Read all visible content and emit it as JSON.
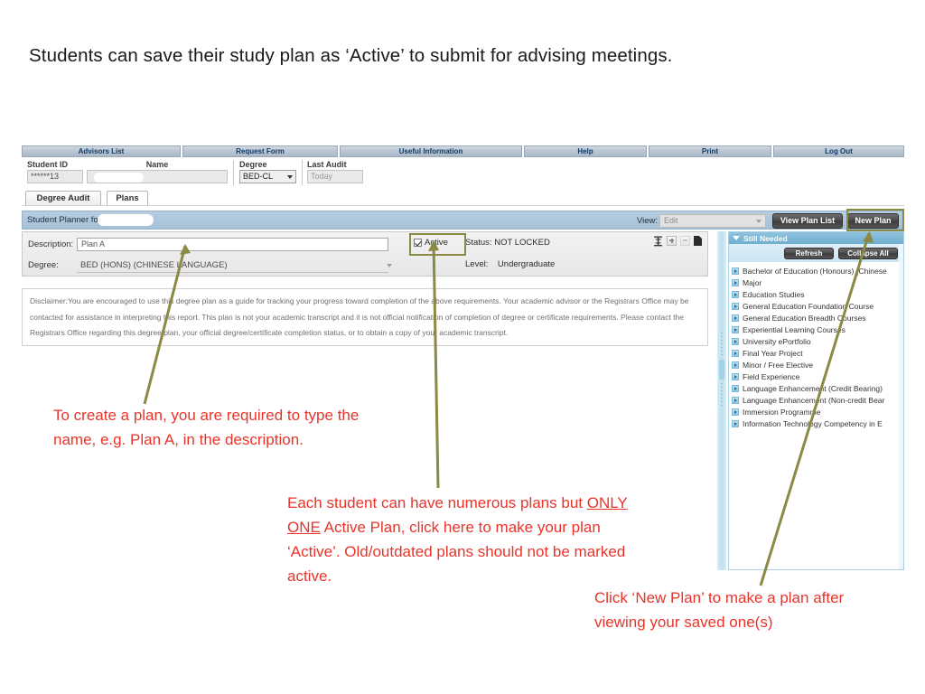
{
  "slide": {
    "title": "Students can save their study plan as ‘Active’ to submit for advising meetings."
  },
  "app": {
    "nav_tabs": [
      {
        "label": "Advisors List"
      },
      {
        "label": "Request Form"
      },
      {
        "label": "Useful Information"
      },
      {
        "label": "Help"
      },
      {
        "label": "Print"
      },
      {
        "label": "Log Out"
      }
    ],
    "header_fields": {
      "student_id_label": "Student ID",
      "student_id_value": "******13",
      "name_label": "Name",
      "name_value": "",
      "degree_label": "Degree",
      "degree_value": "BED-CL",
      "last_audit_label": "Last Audit",
      "last_audit_value": "Today"
    },
    "sub_tabs": [
      {
        "label": "Degree Audit",
        "active": false
      },
      {
        "label": "Plans",
        "active": true
      }
    ],
    "planner_bar": {
      "planner_label": "Student Planner for: ,",
      "view_label": "View:",
      "view_value": "Edit",
      "view_plan_list_button": "View Plan List",
      "new_plan_button": "New Plan"
    },
    "plan_detail": {
      "description_label": "Description:",
      "description_value": "Plan A",
      "degree_label": "Degree:",
      "degree_value": "BED (HONS) (CHINESE LANGUAGE)",
      "active_label": "Active",
      "active_checked": true,
      "status_text": "Status: NOT LOCKED",
      "level_label": "Level:",
      "level_value": "Undergraduate",
      "icons": [
        "insert-icon",
        "add-icon",
        "remove-icon",
        "note-icon"
      ]
    },
    "disclaimer": "Disclaimer:You are encouraged to use this degree plan as a guide for tracking your progress toward completion of the above requirements. Your academic advisor or the Registrars Office may be contacted for assistance in interpreting this report. This plan is not your academic transcript and it is not official notification of completion of degree or certificate requirements. Please contact the Registrars Office regarding this degree plan, your official degree/certificate completion status, or to obtain a copy of your academic transcript.",
    "still_needed": {
      "title": "Still Needed",
      "refresh_button": "Refresh",
      "collapse_all_button": "Collapse All",
      "items": [
        "Bachelor of Education (Honours) (Chinese",
        "Major",
        "Education Studies",
        "General Education Foundation Course",
        "General Education Breadth Courses",
        "Experiential Learning Courses",
        "University ePortfolio",
        "Final Year Project",
        "Minor / Free Elective",
        "Field Experience",
        "Language Enhancement (Credit Bearing)",
        "Language Enhancement (Non-credit Bear",
        "Immersion Programme",
        "Information Technology Competency in E"
      ]
    }
  },
  "annotations": [
    {
      "id": "description-note",
      "text": "To create a plan, you are required to type the name, e.g. Plan A, in the description."
    },
    {
      "id": "active-note-part1",
      "text": "Each student can have numerous plans but "
    },
    {
      "id": "active-note-underlined",
      "text": "ONLY ONE"
    },
    {
      "id": "active-note-part2",
      "text": " Active Plan, click here to make your plan ‘Active’. Old/outdated plans should not be marked active."
    },
    {
      "id": "new-plan-note",
      "text": "Click ‘New Plan’ to make a plan after viewing your saved one(s)"
    }
  ],
  "colors": {
    "annotation_red": "#e8342b",
    "highlight_olive": "#8a8a45",
    "nav_blue": "#123a66",
    "planner_blue": "#a6c0d6",
    "panel_header_blue": "#6fafd0"
  }
}
